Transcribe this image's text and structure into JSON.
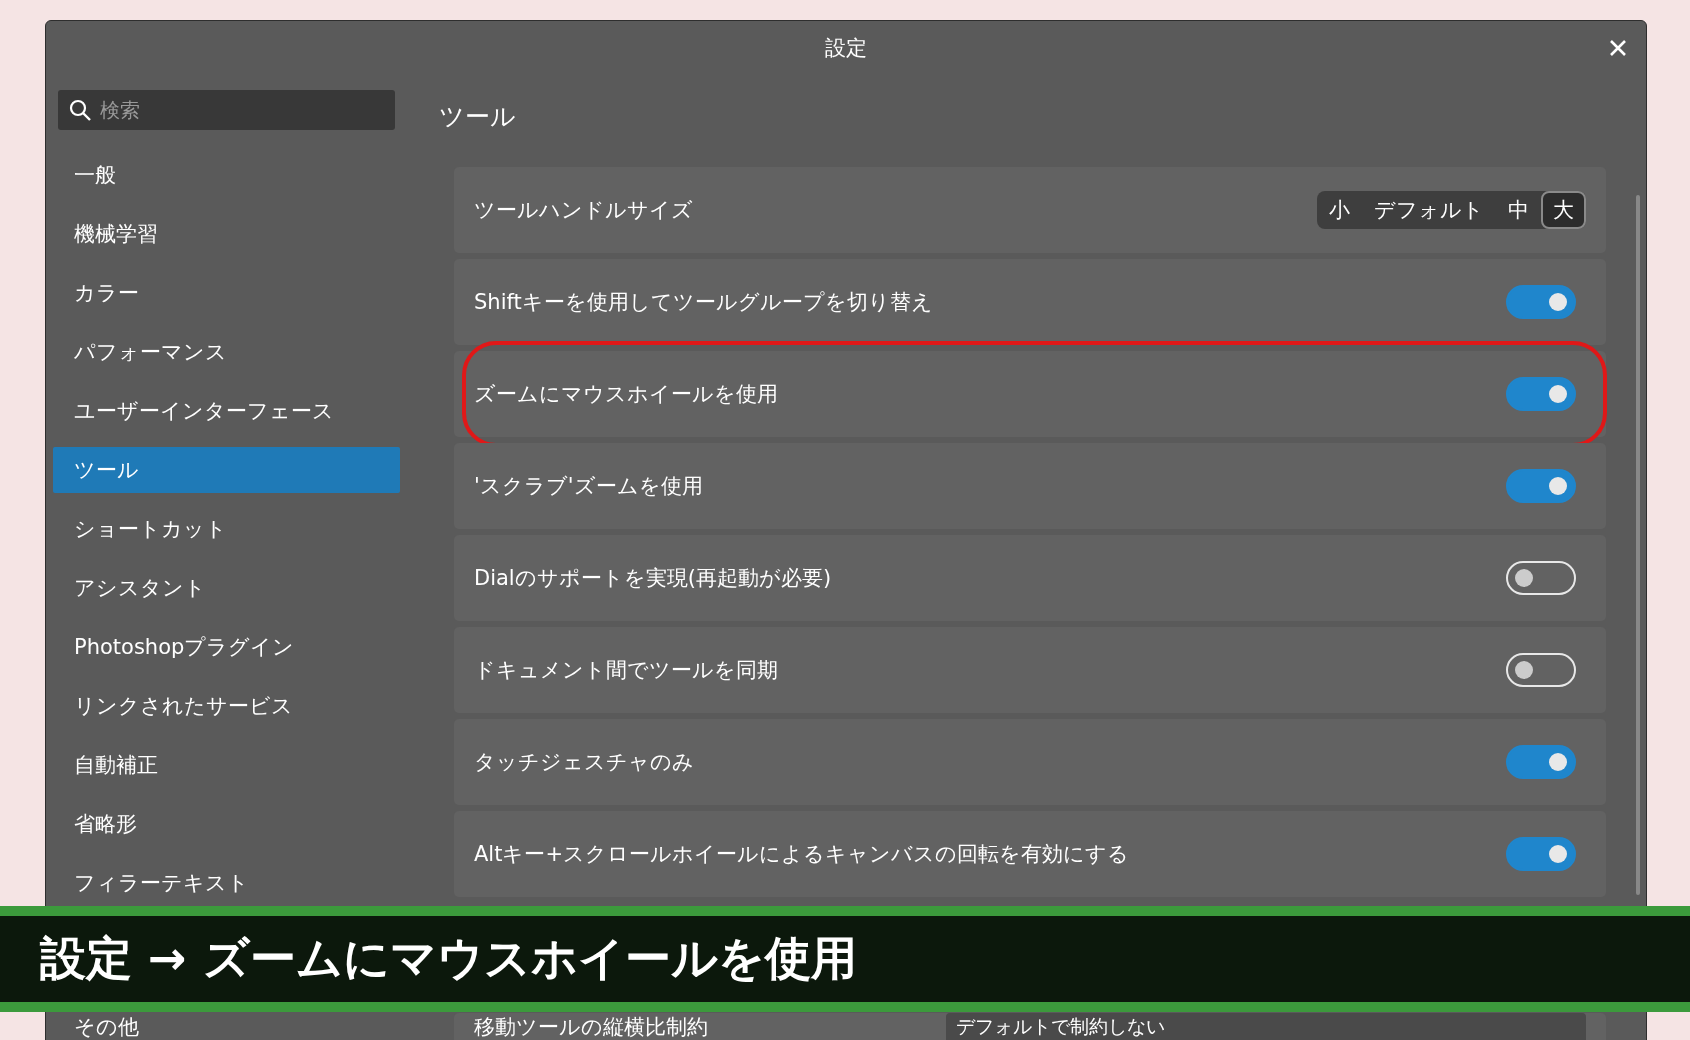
{
  "window": {
    "title": "設定"
  },
  "search": {
    "placeholder": "検索"
  },
  "sidebar": {
    "items": [
      {
        "label": "一般",
        "selected": false
      },
      {
        "label": "機械学習",
        "selected": false
      },
      {
        "label": "カラー",
        "selected": false
      },
      {
        "label": "パフォーマンス",
        "selected": false
      },
      {
        "label": "ユーザーインターフェース",
        "selected": false
      },
      {
        "label": "ツール",
        "selected": true
      },
      {
        "label": "ショートカット",
        "selected": false
      },
      {
        "label": "アシスタント",
        "selected": false
      },
      {
        "label": "Photoshopプラグイン",
        "selected": false
      },
      {
        "label": "リンクされたサービス",
        "selected": false
      },
      {
        "label": "自動補正",
        "selected": false
      },
      {
        "label": "省略形",
        "selected": false
      },
      {
        "label": "フィラーテキスト",
        "selected": false
      }
    ],
    "lower_items": [
      {
        "label": "その他",
        "selected": false
      }
    ]
  },
  "content": {
    "heading": "ツール",
    "rows": [
      {
        "kind": "segmented",
        "label": "ツールハンドルサイズ",
        "highlighted": false,
        "options": [
          {
            "label": "小",
            "selected": false
          },
          {
            "label": "デフォルト",
            "selected": false
          },
          {
            "label": "中",
            "selected": false
          },
          {
            "label": "大",
            "selected": true
          }
        ]
      },
      {
        "kind": "toggle",
        "label": "Shiftキーを使用してツールグループを切り替え",
        "on": true,
        "highlighted": false
      },
      {
        "kind": "toggle",
        "label": "ズームにマウスホイールを使用",
        "on": true,
        "highlighted": true
      },
      {
        "kind": "toggle",
        "label": "'スクラブ'ズームを使用",
        "on": true,
        "highlighted": false
      },
      {
        "kind": "toggle",
        "label": "Dialのサポートを実現(再起動が必要)",
        "on": false,
        "highlighted": false
      },
      {
        "kind": "toggle",
        "label": "ドキュメント間でツールを同期",
        "on": false,
        "highlighted": false
      },
      {
        "kind": "toggle",
        "label": "タッチジェスチャのみ",
        "on": true,
        "highlighted": false
      },
      {
        "kind": "toggle",
        "label": "Altキー+スクロールホイールによるキャンバスの回転を有効にする",
        "on": true,
        "highlighted": false
      }
    ],
    "lower_rows": [
      {
        "kind": "dropdown",
        "label": "移動ツールの縦横比制約",
        "value": "デフォルトで制約しない"
      }
    ]
  },
  "caption": {
    "text": "設定 → ズームにマウスホイールを使用"
  }
}
